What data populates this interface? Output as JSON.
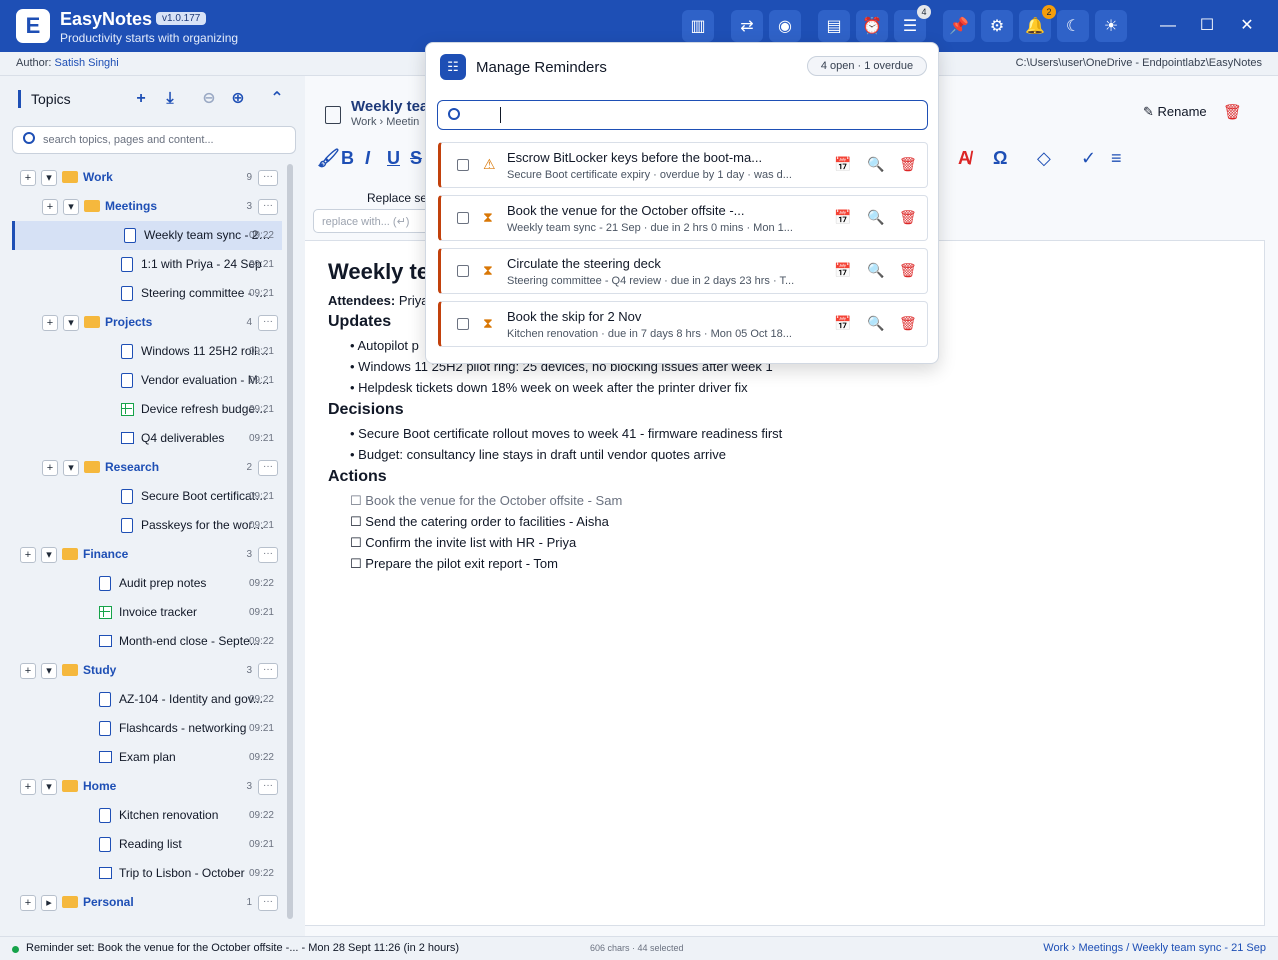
{
  "app": {
    "name": "EasyNotes",
    "version": "v1.0.177",
    "tagline": "Productivity starts with organizing"
  },
  "toolbar_icons": [
    "chart-icon",
    "swap-icon",
    "robot-icon",
    "calendar-icon",
    "alarm-icon",
    "tasks-icon",
    "pin-icon",
    "gear-icon",
    "bell-icon",
    "moon-icon",
    "sun-icon"
  ],
  "badges": {
    "tasks": "4",
    "bell": "2"
  },
  "author": {
    "label": "Author:",
    "name": "Satish Singhi"
  },
  "path": "C:\\Users\\user\\OneDrive - Endpointlabz\\EasyNotes",
  "sidebar": {
    "title": "Topics",
    "search_placeholder": "search topics, pages and content...",
    "tree": [
      {
        "kind": "folder",
        "name": "Work",
        "count": "9",
        "level": 0
      },
      {
        "kind": "folder",
        "name": "Meetings",
        "count": "3",
        "level": 1
      },
      {
        "kind": "doc",
        "name": "Weekly team sync - 21...",
        "time": "09:22",
        "level": 2,
        "selected": true
      },
      {
        "kind": "doc",
        "name": "1:1 with Priya - 24 Sep",
        "time": "09:21",
        "level": 2
      },
      {
        "kind": "doc",
        "name": "Steering committee - Q...",
        "time": "09:21",
        "level": 2
      },
      {
        "kind": "folder",
        "name": "Projects",
        "count": "4",
        "level": 1
      },
      {
        "kind": "doc",
        "name": "Windows 11 25H2 rollout",
        "time": "09:21",
        "level": 2
      },
      {
        "kind": "doc",
        "name": "Vendor evaluation - MD...",
        "time": "09:21",
        "level": 2
      },
      {
        "kind": "sheet",
        "name": "Device refresh budget 2...",
        "time": "09:21",
        "level": 2
      },
      {
        "kind": "list",
        "name": "Q4 deliverables",
        "time": "09:21",
        "level": 2
      },
      {
        "kind": "folder",
        "name": "Research",
        "count": "2",
        "level": 1
      },
      {
        "kind": "doc",
        "name": "Secure Boot certificate...",
        "time": "09:21",
        "level": 2
      },
      {
        "kind": "doc",
        "name": "Passkeys for the workfo...",
        "time": "09:21",
        "level": 2
      },
      {
        "kind": "folder",
        "name": "Finance",
        "count": "3",
        "level": 0
      },
      {
        "kind": "doc",
        "name": "Audit prep notes",
        "time": "09:22",
        "level": 1
      },
      {
        "kind": "sheet",
        "name": "Invoice tracker",
        "time": "09:21",
        "level": 1
      },
      {
        "kind": "list",
        "name": "Month-end close - Septe...",
        "time": "09:22",
        "level": 1
      },
      {
        "kind": "folder",
        "name": "Study",
        "count": "3",
        "level": 0
      },
      {
        "kind": "doc",
        "name": "AZ-104 - Identity and gov...",
        "time": "09:22",
        "level": 1
      },
      {
        "kind": "doc",
        "name": "Flashcards - networking",
        "time": "09:21",
        "level": 1
      },
      {
        "kind": "list",
        "name": "Exam plan",
        "time": "09:22",
        "level": 1
      },
      {
        "kind": "folder",
        "name": "Home",
        "count": "3",
        "level": 0
      },
      {
        "kind": "doc",
        "name": "Kitchen renovation",
        "time": "09:22",
        "level": 1
      },
      {
        "kind": "doc",
        "name": "Reading list",
        "time": "09:21",
        "level": 1
      },
      {
        "kind": "list",
        "name": "Trip to Lisbon - October",
        "time": "09:22",
        "level": 1
      },
      {
        "kind": "folder",
        "name": "Personal",
        "count": "1",
        "level": 0,
        "collapsed": true
      }
    ]
  },
  "editor": {
    "title": "Weekly tea",
    "crumb": "Work › Meetin",
    "rename_label": "Rename",
    "replace_label": "Replace sel",
    "replace_placeholder": "replace with... (↵)",
    "doc": {
      "heading": "Weekly te",
      "attendees_label": "Attendees:",
      "attendees": "Priya",
      "sections": [
        {
          "title": "Updates",
          "bullets": [
            "Autopilot p",
            "Windows 11 25H2 pilot ring: 25 devices, no blocking issues after week 1",
            "Helpdesk tickets down 18% week on week after the printer driver fix"
          ]
        },
        {
          "title": "Decisions",
          "bullets": [
            "Secure Boot certificate rollout moves to week 41 - firmware readiness first",
            "Budget: consultancy line stays in draft until vendor quotes arrive"
          ]
        },
        {
          "title": "Actions",
          "todos": [
            "Book the venue for the October offsite - Sam",
            "Send the catering order to facilities - Aisha",
            "Confirm the invite list with HR - Priya",
            "Prepare the pilot exit report - Tom"
          ]
        }
      ]
    }
  },
  "reminders": {
    "title": "Manage Reminders",
    "summary": "4 open  ·  1 overdue",
    "items": [
      {
        "status": "overdue",
        "title": "Escrow BitLocker keys before the boot-ma...",
        "meta": "Secure Boot certificate expiry  ·  overdue by 1 day  ·  was d..."
      },
      {
        "status": "pending",
        "title": "Book the venue for the October offsite -...",
        "meta": "Weekly team sync - 21 Sep  ·  due in 2 hrs 0 mins  ·  Mon 1..."
      },
      {
        "status": "pending",
        "title": "Circulate the steering deck",
        "meta": "Steering committee - Q4 review  ·  due in 2 days 23 hrs  ·  T..."
      },
      {
        "status": "pending",
        "title": "Book the skip for 2 Nov",
        "meta": "Kitchen renovation  ·  due in 7 days 8 hrs  ·  Mon 05 Oct 18..."
      }
    ]
  },
  "status": {
    "message": "Reminder set: Book the venue for the October offsite -... - Mon 28 Sept 11:26 (in 2 hours)",
    "chars": "606 chars · 44 selected",
    "breadcrumb": "Work › Meetings / Weekly team sync - 21 Sep"
  },
  "colors": {
    "brand": "#1e4fb5",
    "overdue": "#d97706",
    "danger": "#dc2626",
    "folder": "#f5b83d"
  }
}
